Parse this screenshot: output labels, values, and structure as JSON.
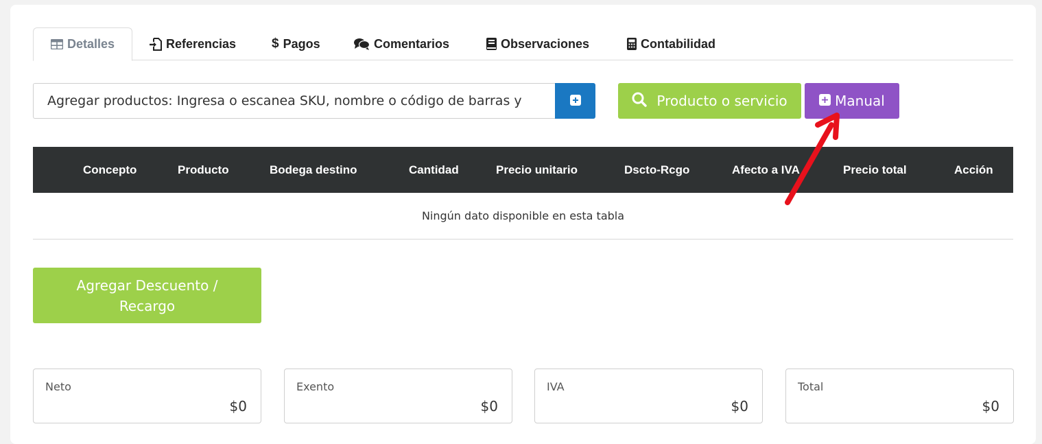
{
  "tabs": [
    {
      "label": "Detalles",
      "icon": "table-icon",
      "active": true
    },
    {
      "label": "Referencias",
      "icon": "file-import-icon"
    },
    {
      "label": "Pagos",
      "icon": "dollar-icon"
    },
    {
      "label": "Comentarios",
      "icon": "comments-icon"
    },
    {
      "label": "Observaciones",
      "icon": "book-icon"
    },
    {
      "label": "Contabilidad",
      "icon": "calculator-icon"
    }
  ],
  "search": {
    "placeholder": "Agregar productos: Ingresa o escanea SKU, nombre o código de barras y"
  },
  "buttons": {
    "product_label": "Producto o servicio",
    "manual_label": "Manual",
    "discount_label": "Agregar Descuento / Recargo"
  },
  "table": {
    "columns": [
      "Concepto",
      "Producto",
      "Bodega destino",
      "Cantidad",
      "Precio unitario",
      "Dscto-Rcgo",
      "Afecto a IVA",
      "Precio total",
      "Acción"
    ],
    "empty_text": "Ningún dato disponible en esta tabla"
  },
  "totals": [
    {
      "label": "Neto",
      "value": "$0"
    },
    {
      "label": "Exento",
      "value": "$0"
    },
    {
      "label": "IVA",
      "value": "$0"
    },
    {
      "label": "Total",
      "value": "$0"
    }
  ],
  "colors": {
    "primary_blue": "#1a78c2",
    "green": "#9dd04a",
    "purple": "#8f53c6",
    "table_header": "#2f3233",
    "annotation_red": "#e8111c"
  }
}
